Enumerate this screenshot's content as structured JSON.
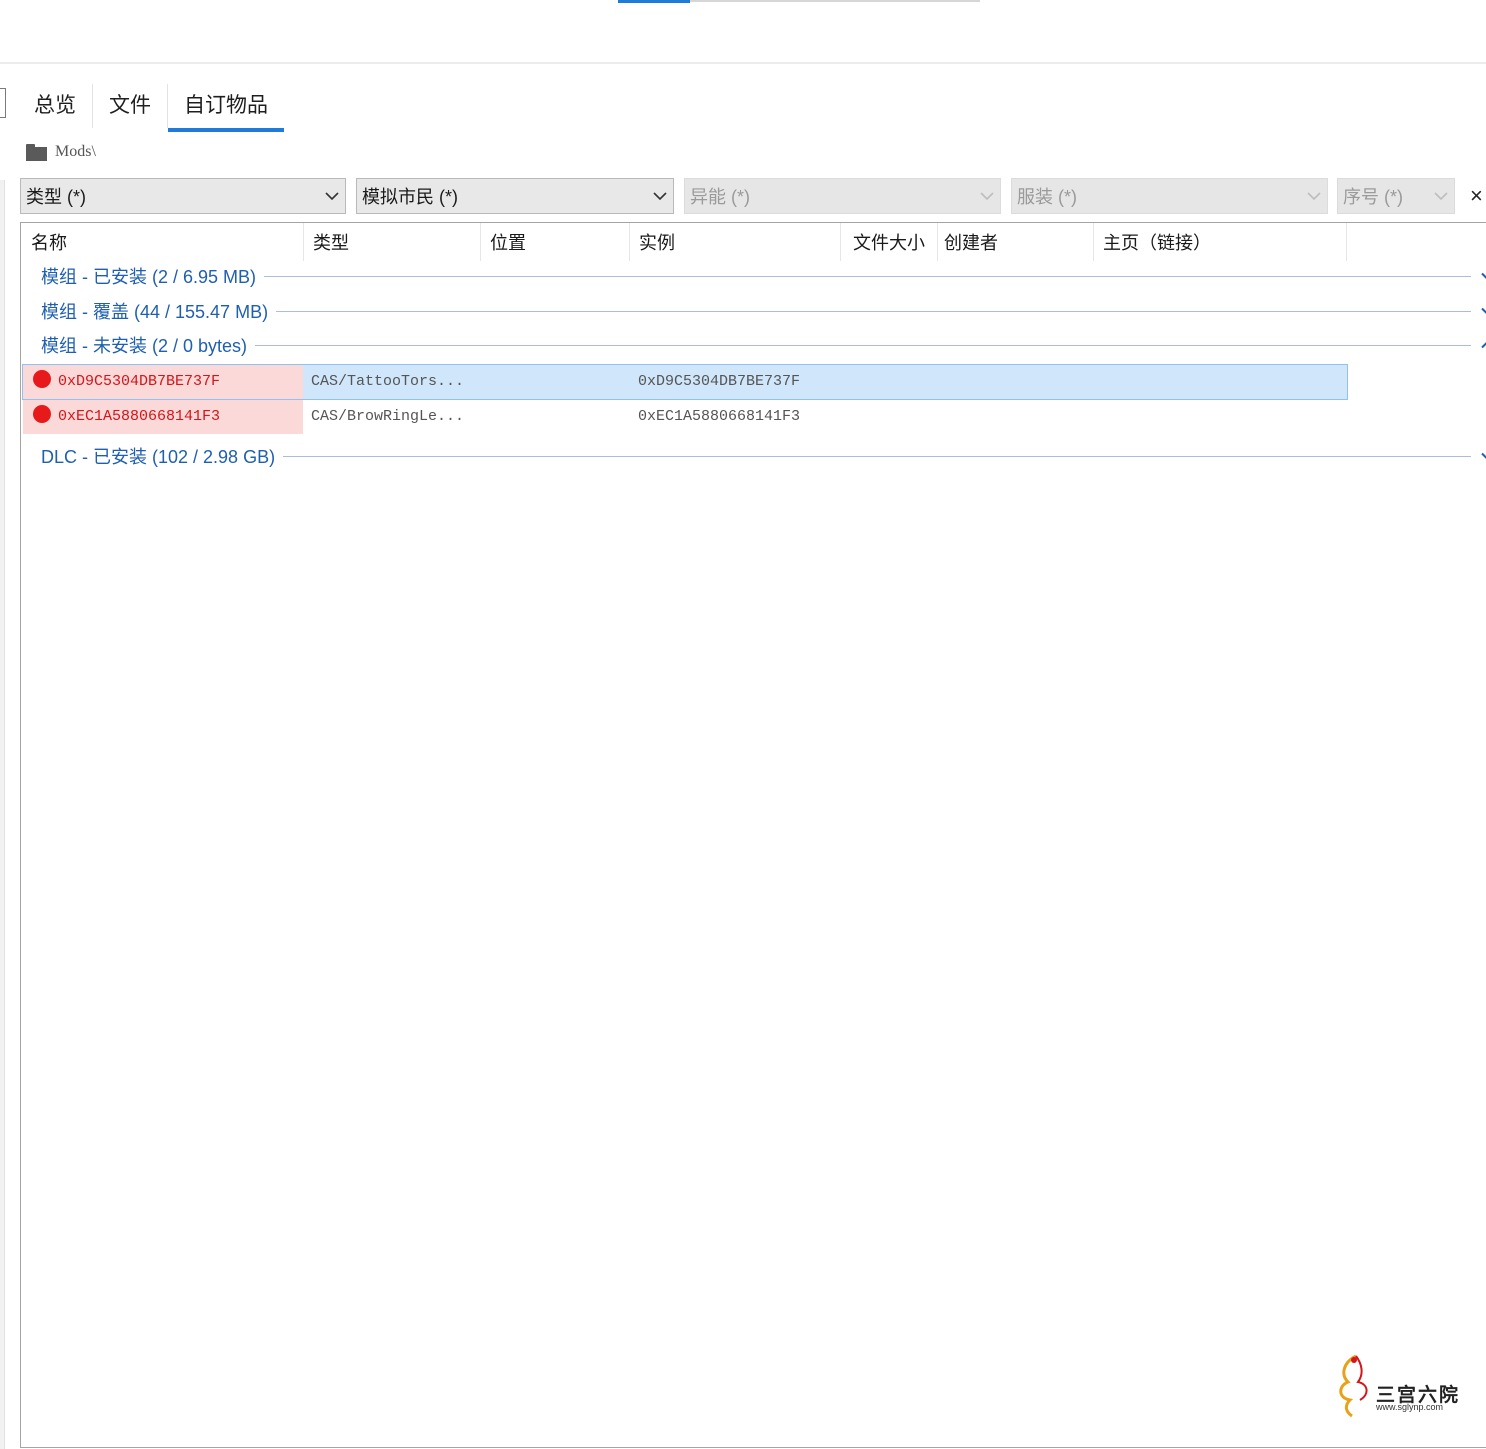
{
  "tabs": [
    {
      "label": "总览"
    },
    {
      "label": "文件"
    },
    {
      "label": "自订物品",
      "active": true
    }
  ],
  "path": {
    "text": "Mods\\"
  },
  "filters": [
    {
      "label": "类型 (*)",
      "enabled": true
    },
    {
      "label": "模拟市民 (*)",
      "enabled": true
    },
    {
      "label": "异能 (*)",
      "enabled": false
    },
    {
      "label": "服装 (*)",
      "enabled": false
    },
    {
      "label": "序号 (*)",
      "enabled": false
    }
  ],
  "close_label": "×",
  "columns": [
    "名称",
    "类型",
    "位置",
    "实例",
    "文件大小",
    "创建者",
    "主页（链接）"
  ],
  "groups": [
    {
      "label": "模组 - 已安装  (2 / 6.95 MB)",
      "expanded": false
    },
    {
      "label": "模组 - 覆盖  (44 / 155.47 MB)",
      "expanded": false
    },
    {
      "label": "模组 - 未安装  (2 / 0 bytes)",
      "expanded": true
    },
    {
      "label": "DLC - 已安装  (102 / 2.98 GB)",
      "expanded": false
    }
  ],
  "rows": [
    {
      "name": "0xD9C5304DB7BE737F",
      "type": "CAS/TattooTors...",
      "location": "",
      "instance": "0xD9C5304DB7BE737F",
      "size": "",
      "creator": "",
      "homepage": "",
      "selected": true,
      "status": "error"
    },
    {
      "name": "0xEC1A5880668141F3",
      "type": "CAS/BrowRingLe...",
      "location": "",
      "instance": "0xEC1A5880668141F3",
      "size": "",
      "creator": "",
      "homepage": "",
      "selected": false,
      "status": "error"
    }
  ],
  "watermark": {
    "text": "三宫六院",
    "url": "www.sglynp.com"
  },
  "colors": {
    "accent": "#1e7bd7",
    "group_text": "#1f5fb0",
    "error": "#e8191b",
    "selected_row": "#cfe6fb"
  }
}
